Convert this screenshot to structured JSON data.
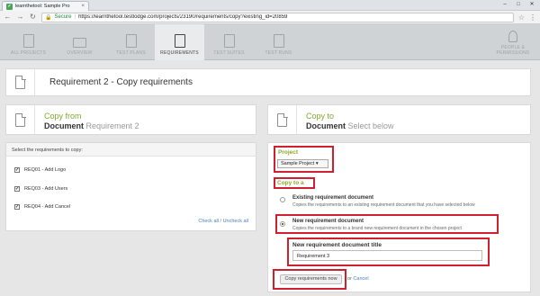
{
  "browser": {
    "tab_title": "learnthetool: Sample Pro",
    "secure_label": "Secure",
    "url": "https://learnthetool.testlodge.com/projects/23190/requirements/copy?existing_id=20859",
    "controls": {
      "minimize": "–",
      "maximize": "□",
      "close": "✕"
    }
  },
  "nav": {
    "items": [
      {
        "label": "All Projects",
        "icon": "folder-icon"
      },
      {
        "label": "Overview",
        "icon": "screen-icon"
      },
      {
        "label": "Test Plans",
        "icon": "document-icon"
      },
      {
        "label": "Requirements",
        "icon": "document-icon"
      },
      {
        "label": "Test Suites",
        "icon": "list-icon"
      },
      {
        "label": "Test Runs",
        "icon": "list-icon"
      }
    ],
    "active": "Requirements",
    "people": {
      "line1": "People &",
      "line2": "Permissions",
      "icon": "person-icon"
    }
  },
  "page": {
    "title": "Requirement 2 - Copy requirements"
  },
  "copy_from": {
    "heading": "Copy from",
    "doc_label": "Document",
    "doc_name": "Requirement 2",
    "select_label": "Select the requirements to copy:",
    "requirements": [
      {
        "code": "REQ01 - Add Logo",
        "checked": true
      },
      {
        "code": "REQ03 - Add Users",
        "checked": true
      },
      {
        "code": "REQ04 - Add Cancel",
        "checked": true
      }
    ],
    "check_all": "Check all",
    "sep": " / ",
    "uncheck_all": "Uncheck all"
  },
  "copy_to": {
    "heading": "Copy to",
    "doc_label": "Document",
    "doc_hint": "Select below",
    "project_label": "Project",
    "project_value": "Sample Project",
    "copy_to_a_label": "Copy to a",
    "options": [
      {
        "title": "Existing requirement document",
        "desc": "Copies the requirements to an existing requirement document that you have selected below",
        "selected": false
      },
      {
        "title": "New requirement document",
        "desc": "Copies the requirements to a brand new requirement document in the chosen project",
        "selected": true
      }
    ],
    "new_doc_title_label": "New requirement document title",
    "new_doc_title_value": "Requirement 3",
    "submit_label": "Copy requirements now",
    "or_text": "or",
    "cancel_label": "Cancel"
  },
  "colors": {
    "accent_green": "#8fa62a",
    "highlight_red": "#d02030",
    "link_blue": "#4a7fbf"
  }
}
